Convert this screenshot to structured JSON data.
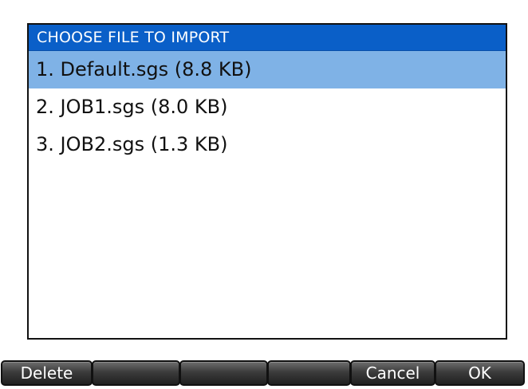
{
  "dialog": {
    "title": "CHOOSE FILE TO IMPORT",
    "files": [
      {
        "label": "1. Default.sgs (8.8 KB)",
        "selected": true
      },
      {
        "label": "2. JOB1.sgs (8.0 KB)",
        "selected": false
      },
      {
        "label": "3. JOB2.sgs (1.3 KB)",
        "selected": false
      }
    ]
  },
  "softkeys": {
    "delete_label": "Delete",
    "key2_label": "",
    "key3_label": "",
    "key4_label": "",
    "cancel_label": "Cancel",
    "ok_label": "OK"
  },
  "colors": {
    "title_bar": "#0a5fc8",
    "selection": "#7fb2e6",
    "softkey_dark": "#202020"
  }
}
